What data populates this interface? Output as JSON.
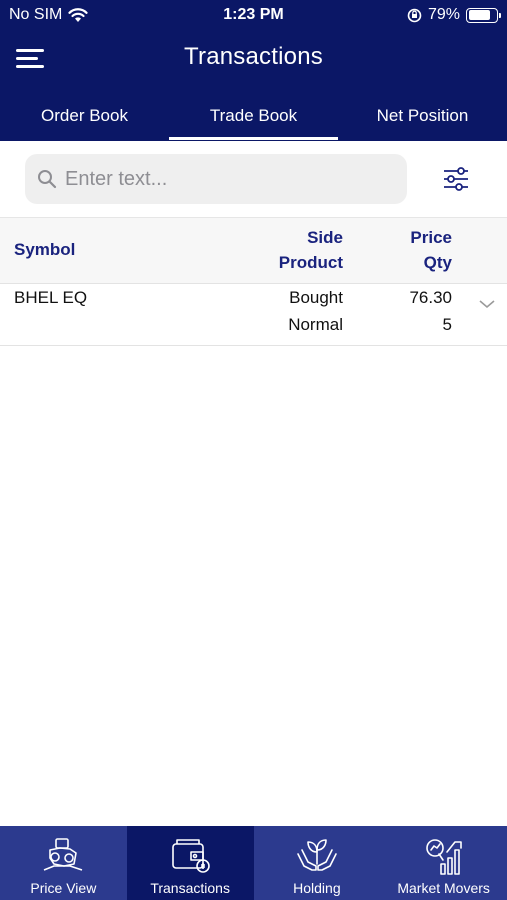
{
  "status_bar": {
    "carrier": "No SIM",
    "time": "1:23 PM",
    "battery_percent": "79%",
    "battery_level": 0.79
  },
  "header": {
    "title": "Transactions"
  },
  "tabs": [
    {
      "label": "Order Book",
      "active": false
    },
    {
      "label": "Trade Book",
      "active": true
    },
    {
      "label": "Net Position",
      "active": false
    }
  ],
  "search": {
    "placeholder": "Enter text...",
    "value": ""
  },
  "table": {
    "headers": {
      "symbol": "Symbol",
      "side": "Side",
      "product": "Product",
      "price": "Price",
      "qty": "Qty"
    },
    "rows": [
      {
        "symbol": "BHEL EQ",
        "side": "Bought",
        "product": "Normal",
        "price": "76.30",
        "qty": "5"
      }
    ]
  },
  "bottom_nav": [
    {
      "label": "Price View",
      "icon": "price-view-icon",
      "active": false
    },
    {
      "label": "Transactions",
      "icon": "wallet-icon",
      "active": true
    },
    {
      "label": "Holding",
      "icon": "plant-hands-icon",
      "active": false
    },
    {
      "label": "Market Movers",
      "icon": "chart-magnifier-icon",
      "active": false
    }
  ],
  "colors": {
    "primary": "#0b1766",
    "nav_bg": "#2c3a8e",
    "header_text": "#1a237e"
  }
}
